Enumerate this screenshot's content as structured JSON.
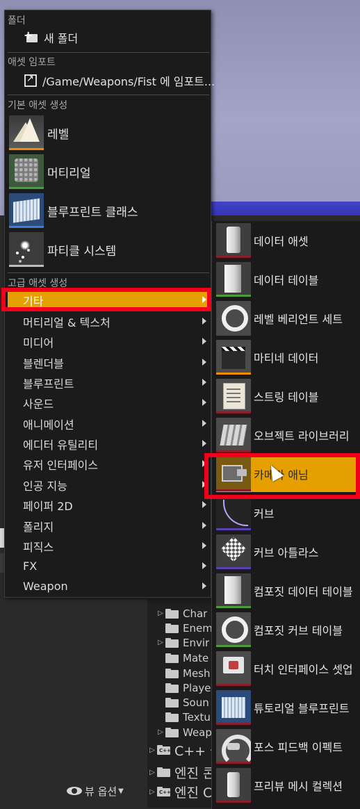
{
  "primary_menu": {
    "section_folder": "폴더",
    "new_folder": "새 폴더",
    "section_import": "애셋 임포트",
    "import_path": "/Game/Weapons/Fist 에 임포트...",
    "section_basic": "기본 애셋 생성",
    "basic_items": [
      {
        "label": "레벨",
        "icon": "level-icon"
      },
      {
        "label": "머티리얼",
        "icon": "material-icon"
      },
      {
        "label": "블루프린트 클래스",
        "icon": "blueprint-icon"
      },
      {
        "label": "파티클 시스템",
        "icon": "particle-icon"
      }
    ],
    "section_advanced": "고급 애셋 생성",
    "categories": [
      "기타",
      "머티리얼 & 텍스처",
      "미디어",
      "블렌더블",
      "블루프린트",
      "사운드",
      "애니메이션",
      "에디터 유틸리티",
      "유저 인터페이스",
      "인공 지능",
      "페이퍼 2D",
      "폴리지",
      "피직스",
      "FX",
      "Weapon"
    ],
    "active_category": "기타"
  },
  "sub_menu": {
    "items": [
      {
        "label": "데이터 애셋",
        "icon": "data-asset-icon"
      },
      {
        "label": "데이터 테이블",
        "icon": "data-table-icon"
      },
      {
        "label": "레벨 베리언트 세트",
        "icon": "level-variant-icon"
      },
      {
        "label": "마티네 데이터",
        "icon": "matinee-icon"
      },
      {
        "label": "스트링 테이블",
        "icon": "string-table-icon"
      },
      {
        "label": "오브젝트 라이브러리",
        "icon": "object-library-icon"
      },
      {
        "label": "카메라 애님",
        "icon": "camera-anim-icon"
      },
      {
        "label": "커브",
        "icon": "curve-icon"
      },
      {
        "label": "커브 아틀라스",
        "icon": "curve-atlas-icon"
      },
      {
        "label": "컴포짓 데이터 테이블",
        "icon": "composite-data-table-icon"
      },
      {
        "label": "컴포짓 커브 테이블",
        "icon": "composite-curve-table-icon"
      },
      {
        "label": "터치 인터페이스 셋업",
        "icon": "touch-interface-icon"
      },
      {
        "label": "튜토리얼 블루프린트",
        "icon": "tutorial-blueprint-icon"
      },
      {
        "label": "포스 피드백 이펙트",
        "icon": "force-feedback-icon"
      },
      {
        "label": "프리뷰 메시 컬렉션",
        "icon": "preview-mesh-icon"
      }
    ],
    "highlighted_item": "카메라 애님"
  },
  "content_browser": {
    "folders": [
      "Char",
      "Enem",
      "Envir",
      "Mate",
      "Mesh",
      "Playe",
      "Soun",
      "Textu",
      "Weap"
    ],
    "roots": [
      "C++ 클",
      "엔진 콘",
      "엔진 C"
    ],
    "view_options": "뷰 옵션"
  },
  "colors": {
    "highlight": "#e5a000",
    "annotation_red": "#f0001a",
    "menu_bg": "#1b1b1b"
  }
}
